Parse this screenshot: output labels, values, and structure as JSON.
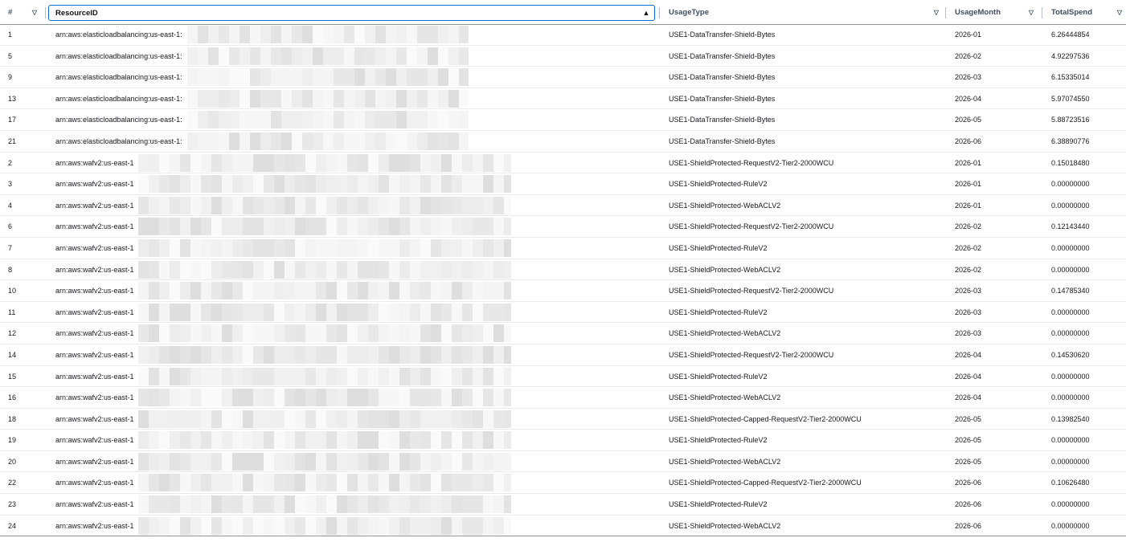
{
  "columns": {
    "num": "#",
    "resource": "ResourceID",
    "usage": "UsageType",
    "month": "UsageMonth",
    "spend": "TotalSpend"
  },
  "icons": {
    "filter": "filter-triangle-icon",
    "sort": "sort-ascending-icon"
  },
  "rows": [
    {
      "n": "1",
      "res": "arn:aws:elasticloadbalancing:us-east-1:",
      "usage": "USE1-DataTransfer-Shield-Bytes",
      "month": "2026-01",
      "spend": "6.26444854"
    },
    {
      "n": "5",
      "res": "arn:aws:elasticloadbalancing:us-east-1:",
      "usage": "USE1-DataTransfer-Shield-Bytes",
      "month": "2026-02",
      "spend": "4.92297536"
    },
    {
      "n": "9",
      "res": "arn:aws:elasticloadbalancing:us-east-1:",
      "usage": "USE1-DataTransfer-Shield-Bytes",
      "month": "2026-03",
      "spend": "6.15335014"
    },
    {
      "n": "13",
      "res": "arn:aws:elasticloadbalancing:us-east-1:",
      "usage": "USE1-DataTransfer-Shield-Bytes",
      "month": "2026-04",
      "spend": "5.97074550"
    },
    {
      "n": "17",
      "res": "arn:aws:elasticloadbalancing:us-east-1:",
      "usage": "USE1-DataTransfer-Shield-Bytes",
      "month": "2026-05",
      "spend": "5.88723516"
    },
    {
      "n": "21",
      "res": "arn:aws:elasticloadbalancing:us-east-1:",
      "usage": "USE1-DataTransfer-Shield-Bytes",
      "month": "2026-06",
      "spend": "6.38890776"
    },
    {
      "n": "2",
      "res": "arn:aws:wafv2:us-east-1",
      "usage": "USE1-ShieldProtected-RequestV2-Tier2-2000WCU",
      "month": "2026-01",
      "spend": "0.15018480"
    },
    {
      "n": "3",
      "res": "arn:aws:wafv2:us-east-1",
      "usage": "USE1-ShieldProtected-RuleV2",
      "month": "2026-01",
      "spend": "0.00000000"
    },
    {
      "n": "4",
      "res": "arn:aws:wafv2:us-east-1",
      "usage": "USE1-ShieldProtected-WebACLV2",
      "month": "2026-01",
      "spend": "0.00000000"
    },
    {
      "n": "6",
      "res": "arn:aws:wafv2:us-east-1",
      "usage": "USE1-ShieldProtected-RequestV2-Tier2-2000WCU",
      "month": "2026-02",
      "spend": "0.12143440"
    },
    {
      "n": "7",
      "res": "arn:aws:wafv2:us-east-1",
      "usage": "USE1-ShieldProtected-RuleV2",
      "month": "2026-02",
      "spend": "0.00000000"
    },
    {
      "n": "8",
      "res": "arn:aws:wafv2:us-east-1",
      "usage": "USE1-ShieldProtected-WebACLV2",
      "month": "2026-02",
      "spend": "0.00000000"
    },
    {
      "n": "10",
      "res": "arn:aws:wafv2:us-east-1",
      "usage": "USE1-ShieldProtected-RequestV2-Tier2-2000WCU",
      "month": "2026-03",
      "spend": "0.14785340"
    },
    {
      "n": "11",
      "res": "arn:aws:wafv2:us-east-1",
      "usage": "USE1-ShieldProtected-RuleV2",
      "month": "2026-03",
      "spend": "0.00000000"
    },
    {
      "n": "12",
      "res": "arn:aws:wafv2:us-east-1",
      "usage": "USE1-ShieldProtected-WebACLV2",
      "month": "2026-03",
      "spend": "0.00000000"
    },
    {
      "n": "14",
      "res": "arn:aws:wafv2:us-east-1",
      "usage": "USE1-ShieldProtected-RequestV2-Tier2-2000WCU",
      "month": "2026-04",
      "spend": "0.14530620"
    },
    {
      "n": "15",
      "res": "arn:aws:wafv2:us-east-1",
      "usage": "USE1-ShieldProtected-RuleV2",
      "month": "2026-04",
      "spend": "0.00000000"
    },
    {
      "n": "16",
      "res": "arn:aws:wafv2:us-east-1",
      "usage": "USE1-ShieldProtected-WebACLV2",
      "month": "2026-04",
      "spend": "0.00000000"
    },
    {
      "n": "18",
      "res": "arn:aws:wafv2:us-east-1",
      "usage": "USE1-ShieldProtected-Capped-RequestV2-Tier2-2000WCU",
      "month": "2026-05",
      "spend": "0.13982540"
    },
    {
      "n": "19",
      "res": "arn:aws:wafv2:us-east-1",
      "usage": "USE1-ShieldProtected-RuleV2",
      "month": "2026-05",
      "spend": "0.00000000"
    },
    {
      "n": "20",
      "res": "arn:aws:wafv2:us-east-1",
      "usage": "USE1-ShieldProtected-WebACLV2",
      "month": "2026-05",
      "spend": "0.00000000"
    },
    {
      "n": "22",
      "res": "arn:aws:wafv2:us-east-1",
      "usage": "USE1-ShieldProtected-Capped-RequestV2-Tier2-2000WCU",
      "month": "2026-06",
      "spend": "0.10626480"
    },
    {
      "n": "23",
      "res": "arn:aws:wafv2:us-east-1",
      "usage": "USE1-ShieldProtected-RuleV2",
      "month": "2026-06",
      "spend": "0.00000000"
    },
    {
      "n": "24",
      "res": "arn:aws:wafv2:us-east-1",
      "usage": "USE1-ShieldProtected-WebACLV2",
      "month": "2026-06",
      "spend": "0.00000000"
    }
  ]
}
